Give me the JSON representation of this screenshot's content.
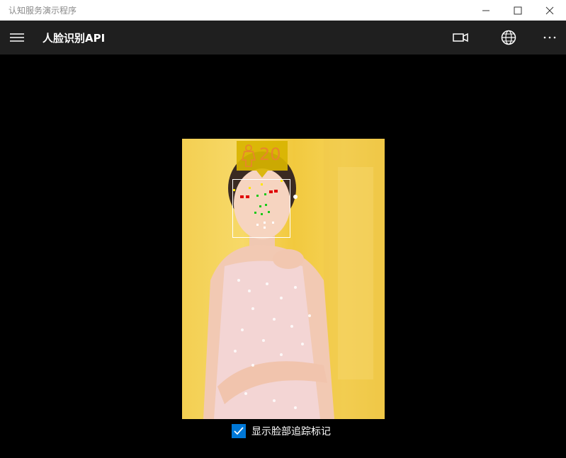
{
  "window": {
    "title": "认知服务演示程序"
  },
  "appbar": {
    "title": "人脸识别API"
  },
  "photo": {
    "age": "20",
    "gender_icon": "female-icon"
  },
  "options": {
    "show_face_tracking_label": "显示脸部追踪标记",
    "show_face_tracking_checked": true
  },
  "colors": {
    "accent": "#0078d7",
    "appbar_bg": "#1f1f1f",
    "age_tag_bg": "#d8b400",
    "age_text": "#e8862b"
  }
}
